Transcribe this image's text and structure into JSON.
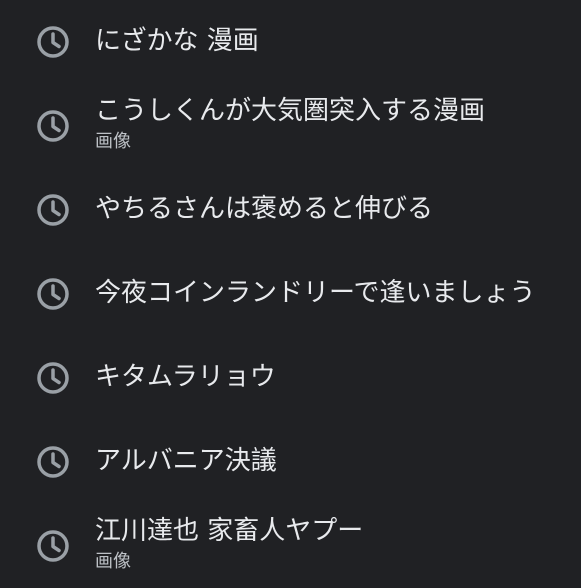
{
  "history": {
    "items": [
      {
        "title": "にざかな 漫画",
        "subtitle": ""
      },
      {
        "title": "こうしくんが大気圏突入する漫画",
        "subtitle": "画像"
      },
      {
        "title": "やちるさんは褒めると伸びる",
        "subtitle": ""
      },
      {
        "title": "今夜コインランドリーで逢いましょう",
        "subtitle": ""
      },
      {
        "title": "キタムラリョウ",
        "subtitle": ""
      },
      {
        "title": "アルバニア決議",
        "subtitle": ""
      },
      {
        "title": "江川達也 家畜人ヤプー",
        "subtitle": "画像"
      }
    ],
    "icon": "clock-icon",
    "colors": {
      "background": "#202124",
      "text": "#e8eaed",
      "subtext": "#bdc1c6",
      "icon": "#9aa0a6"
    }
  }
}
